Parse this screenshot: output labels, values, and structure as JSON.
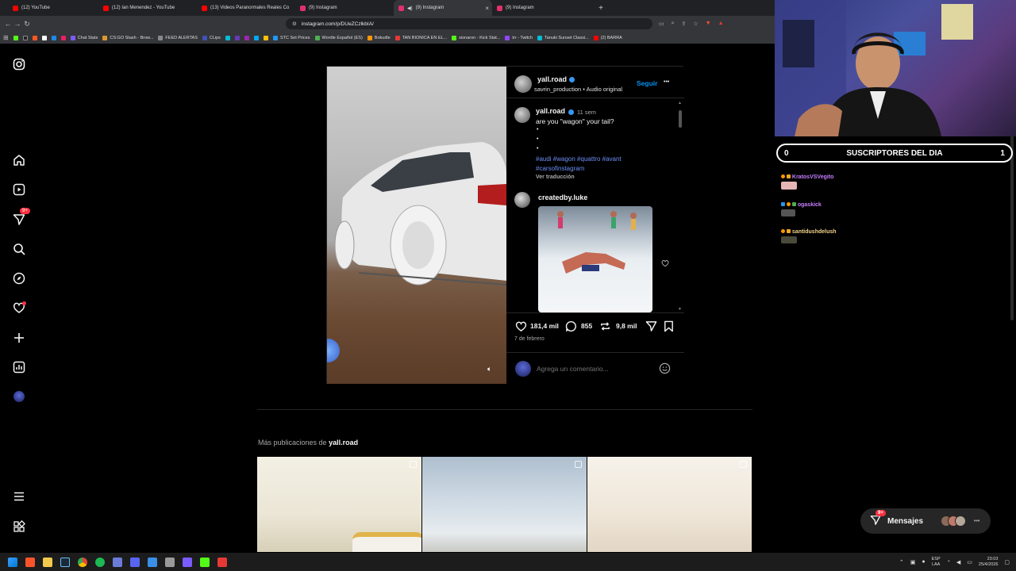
{
  "browser": {
    "tabs": [
      {
        "label": "(12) YouTube",
        "color": "#ff0000"
      },
      {
        "label": "(12) Ian Menendez - YouTube",
        "color": "#ff0000"
      },
      {
        "label": "(13) Videos Paranormales Reales Co",
        "color": "#ff0000"
      },
      {
        "label": "(9) Instagram",
        "color": "#e1306c"
      },
      {
        "label": "(9) Instagram",
        "color": "#e1306c"
      },
      {
        "label": "(9) Instagram",
        "color": "#e1306c"
      }
    ],
    "new_tab": "+",
    "tab_close": "×",
    "url": "instagram.com/p/DUeZCzlkbIA/",
    "bookmarks": [
      {
        "label": "Chat Stats",
        "color": "#7a5cff"
      },
      {
        "label": "CS:GO Stash - Brow...",
        "color": "#d99a2b"
      },
      {
        "label": "FEED ALERTAS",
        "color": "#888888"
      },
      {
        "label": "CLips",
        "color": "#3f51b5"
      },
      {
        "label": "STC Set Prices",
        "color": "#2196f3"
      },
      {
        "label": "Wordle Español (ES)",
        "color": "#4caf50"
      },
      {
        "label": "Bokudle",
        "color": "#ff9800"
      },
      {
        "label": "TAN BIONICA EN EL...",
        "color": "#e53935"
      },
      {
        "label": "sionaron - Kick Stat...",
        "color": "#53fc18"
      },
      {
        "label": "trr - Twitch",
        "color": "#9146ff"
      },
      {
        "label": "Tanuki Sunset Classi...",
        "color": "#00bcd4"
      },
      {
        "label": "(2) BARRA",
        "color": "#ff0000"
      }
    ]
  },
  "sidebar": {
    "notifications_badge": "9+"
  },
  "post": {
    "author": "yall.road",
    "audio_line": "savrin_production • Audio original",
    "follow_label": "Seguir",
    "more": "•••",
    "caption_author": "yall.road",
    "caption_time": "11 sem",
    "caption_text": "are you \"wagon\" your tail?",
    "caption_dots": [
      "•",
      "•",
      "•"
    ],
    "hashtags_line1": "#audi #wagon #quattro #avant",
    "hashtags_line2": "#carsofinstagram",
    "translate_label": "Ver traducción",
    "comment_author": "createdby.luke",
    "likes": "181,4 mil",
    "comments": "855",
    "reposts": "9,8 mil",
    "date": "7 de febrero",
    "comment_placeholder": "Agrega un comentario..."
  },
  "more_posts": {
    "prefix": "Más publicaciones de ",
    "author": "yall.road"
  },
  "messages": {
    "label": "Mensajes",
    "badge": "9+"
  },
  "stream": {
    "subs_left": "0",
    "subs_title": "SUSCRIPTORES DEL DIA",
    "subs_right": "1",
    "chat": [
      {
        "user": "KratosVSVegito",
        "color": "#c77dff"
      },
      {
        "user": "ogaskick",
        "color": "#c77dff"
      },
      {
        "user": "santidushdelush",
        "color": "#f4d58d"
      }
    ]
  },
  "taskbar": {
    "lang": "ESP",
    "lang2": "LAA",
    "time": "23:03",
    "date": "25/4/2026"
  },
  "colors": {
    "accent_blue": "#0095f6",
    "badge_red": "#ff3040"
  }
}
